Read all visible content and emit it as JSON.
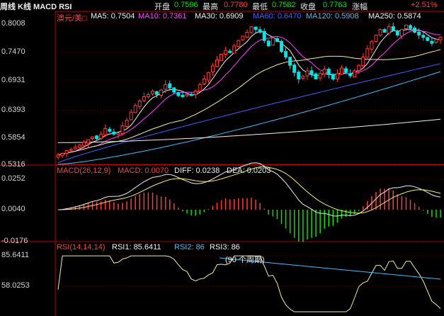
{
  "header": {
    "title": "周线 K线 MACD RSI",
    "open_label": "开盘",
    "open_value": "0.7596",
    "high_label": "最高",
    "high_value": "0.7780",
    "low_label": "最低",
    "low_value": "0.7582",
    "close_label": "收盘",
    "close_value": "0.7763",
    "change_label": "涨幅",
    "change_value": "+2.51%"
  },
  "price_panel": {
    "symbol": "澳元/美□",
    "ma_legend": [
      {
        "label": "MA5: 0.7504",
        "color": "#f0f0f0"
      },
      {
        "label": "MA10: 0.7361",
        "color": "#ff40ff"
      },
      {
        "label": "MA30: 0.6909",
        "color": "#f0f0f0"
      },
      {
        "label": "MA60: 0.6470",
        "color": "#4060ff"
      },
      {
        "label": "MA120: 0.5908",
        "color": "#40c0ff"
      },
      {
        "label": "MA250: 0.5874",
        "color": "#f0f0f0"
      }
    ],
    "y_ticks": [
      "0.8008",
      "0.7470",
      "0.6931",
      "0.6393",
      "0.5854",
      "0.5316"
    ]
  },
  "macd_panel": {
    "legend": [
      {
        "label": "MACD(26,12,9)",
        "color": "#ff4040"
      },
      {
        "label": "MACD: 0.0070",
        "color": "#ff4040"
      },
      {
        "label": "DIFF: 0.0238",
        "color": "#f0f0f0"
      },
      {
        "label": "DEA: 0.0203",
        "color": "#f0f0f0"
      }
    ],
    "y_ticks": [
      "0.0252",
      "0.0040",
      "-0.0176"
    ]
  },
  "rsi_panel": {
    "legend": [
      {
        "label": "RSI(14,14,14)",
        "color": "#ff4040"
      },
      {
        "label": "RSI1: 85.6411",
        "color": "#f0f0f0"
      },
      {
        "label": "RSI2: 86",
        "color": "#40c0ff"
      },
      {
        "label": "RSI3: 86",
        "color": "#f0f0f0"
      }
    ],
    "y_ticks": [
      "85.6411",
      "58.0253"
    ],
    "annotation": "(90 个周期)"
  },
  "chart_data": {
    "type": "candlestick",
    "series_desc": "weekly AUD/USD candles",
    "price_range": [
      0.5316,
      0.8008
    ],
    "macd_range": [
      -0.0176,
      0.0252
    ],
    "rsi_range": [
      40,
      85.6411
    ],
    "closes": [
      0.562,
      0.565,
      0.57,
      0.572,
      0.576,
      0.58,
      0.585,
      0.59,
      0.595,
      0.592,
      0.6,
      0.61,
      0.605,
      0.6,
      0.602,
      0.615,
      0.625,
      0.64,
      0.652,
      0.66,
      0.668,
      0.672,
      0.678,
      0.672,
      0.68,
      0.69,
      0.684,
      0.676,
      0.67,
      0.668,
      0.672,
      0.67,
      0.678,
      0.69,
      0.7,
      0.712,
      0.724,
      0.735,
      0.745,
      0.752,
      0.748,
      0.76,
      0.77,
      0.778,
      0.785,
      0.795,
      0.79,
      0.785,
      0.77,
      0.76,
      0.775,
      0.768,
      0.75,
      0.74,
      0.725,
      0.712,
      0.7,
      0.705,
      0.715,
      0.708,
      0.7,
      0.71,
      0.718,
      0.708,
      0.7,
      0.71,
      0.72,
      0.712,
      0.706,
      0.715,
      0.725,
      0.74,
      0.755,
      0.768,
      0.78,
      0.79,
      0.785,
      0.795,
      0.788,
      0.78,
      0.79,
      0.798,
      0.792,
      0.785,
      0.78,
      0.776,
      0.77,
      0.765,
      0.772,
      0.7763
    ],
    "ma5_last": 0.7504,
    "ma10_last": 0.7361,
    "ma30_last": 0.6909,
    "ma60_last": 0.647,
    "ma120_last": 0.5908,
    "ma250_last": 0.5874,
    "macd_last": 0.007,
    "diff_last": 0.0238,
    "dea_last": 0.0203,
    "rsi1_last": 85.6411,
    "rsi2_last": 86,
    "rsi3_last": 86
  }
}
